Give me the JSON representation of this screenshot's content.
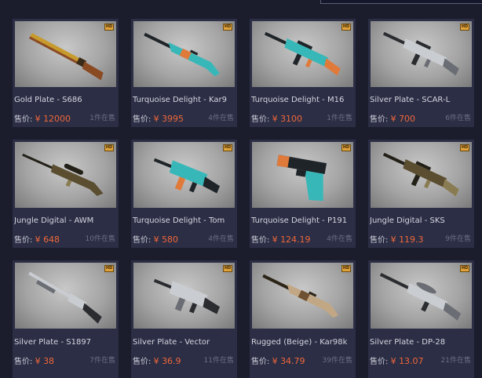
{
  "price_label": "售价:",
  "currency": "¥",
  "badge_text": "HD",
  "colors": {
    "background": "#1b1d2c",
    "card": "#2b2e45",
    "price": "#f0673a",
    "muted": "#6c6f85"
  },
  "items": [
    {
      "name": "Gold Plate - S686",
      "price": "12000",
      "stock": "1件在售",
      "skin": "gold-plate",
      "weapon": "shotgun-double"
    },
    {
      "name": "Turquoise Delight - Kar9",
      "price": "3995",
      "stock": "4件在售",
      "skin": "turquoise-delight",
      "weapon": "bolt-rifle"
    },
    {
      "name": "Turquoise Delight - M16",
      "price": "3100",
      "stock": "1件在售",
      "skin": "turquoise-delight",
      "weapon": "assault-rifle"
    },
    {
      "name": "Silver Plate - SCAR-L",
      "price": "700",
      "stock": "6件在售",
      "skin": "silver-plate",
      "weapon": "assault-rifle"
    },
    {
      "name": "Jungle Digital - AWM",
      "price": "648",
      "stock": "10件在售",
      "skin": "jungle-digital",
      "weapon": "sniper-rifle"
    },
    {
      "name": "Turquoise Delight - Tom",
      "price": "580",
      "stock": "4件在售",
      "skin": "turquoise-delight",
      "weapon": "smg"
    },
    {
      "name": "Turquoise Delight - P191",
      "price": "124.19",
      "stock": "4件在售",
      "skin": "turquoise-delight",
      "weapon": "pistol"
    },
    {
      "name": "Jungle Digital - SKS",
      "price": "119.3",
      "stock": "9件在售",
      "skin": "jungle-digital",
      "weapon": "assault-rifle"
    },
    {
      "name": "Silver Plate - S1897",
      "price": "38",
      "stock": "7件在售",
      "skin": "silver-plate",
      "weapon": "pump-shotgun"
    },
    {
      "name": "Silver Plate - Vector",
      "price": "36.9",
      "stock": "11件在售",
      "skin": "silver-plate",
      "weapon": "smg"
    },
    {
      "name": "Rugged (Beige) - Kar98k",
      "price": "34.79",
      "stock": "39件在售",
      "skin": "rugged-beige",
      "weapon": "bolt-rifle"
    },
    {
      "name": "Silver Plate - DP-28",
      "price": "13.07",
      "stock": "21件在售",
      "skin": "silver-plate",
      "weapon": "lmg"
    }
  ]
}
